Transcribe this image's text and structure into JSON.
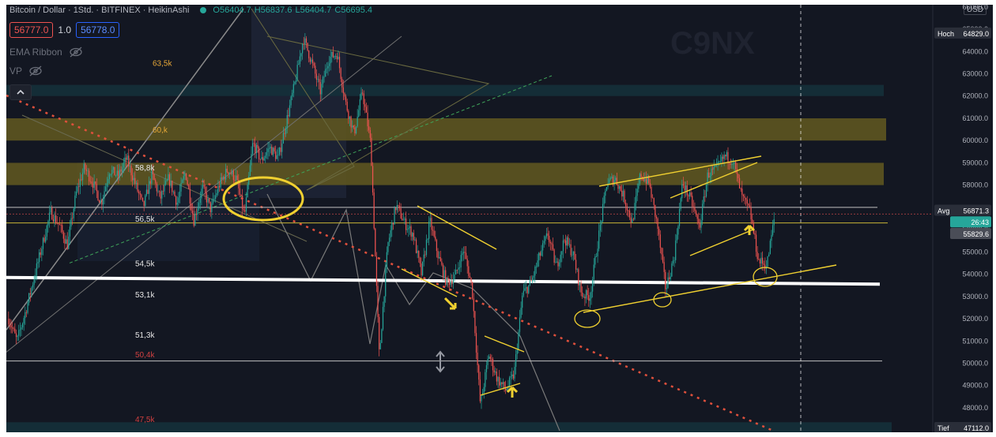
{
  "header": {
    "symbol": "Bitcoin / Dollar · 1Std. · BITFINEX · HeikinAshi",
    "ohlc": {
      "open": "O56404.7",
      "high": "H56837.6",
      "low": "L56404.7",
      "close": "C56695.4"
    },
    "sell_price": "56777.0",
    "spread": "1.0",
    "buy_price": "56778.0",
    "currency": "USD",
    "indicators": [
      {
        "label": "EMA Ribbon",
        "icon": "eye-off-icon"
      },
      {
        "label": "VP",
        "icon": "eye-off-icon"
      }
    ],
    "collapse_icon": "chevron-up-icon"
  },
  "watermark": "C9NX",
  "price_axis": {
    "ticks": [
      "66000.0",
      "65000.0",
      "64000.0",
      "63000.0",
      "62000.0",
      "61000.0",
      "60000.0",
      "59000.0",
      "58000.0",
      "57000.0",
      "56000.0",
      "55000.0",
      "54000.0",
      "53000.0",
      "52000.0",
      "51000.0",
      "50000.0",
      "49000.0",
      "48000.0"
    ],
    "tags": [
      {
        "name": "Hoch",
        "value": "64829.0",
        "bg": "#2a2e39",
        "fg": "#ffffff"
      },
      {
        "name": "Avg",
        "value": "56871.3",
        "bg": "#2a2e39",
        "fg": "#ffffff"
      },
      {
        "name": "",
        "value": "26:43",
        "bg": "#26a69a",
        "fg": "#ffffff"
      },
      {
        "name": "",
        "value": "55829.6",
        "bg": "#4a4d57",
        "fg": "#ffffff"
      },
      {
        "name": "Tief",
        "value": "47112.0",
        "bg": "#2a2e39",
        "fg": "#ffffff"
      }
    ]
  },
  "level_labels": [
    {
      "text": "63,5k",
      "color": "#e8a838"
    },
    {
      "text": "60,k",
      "color": "#e8a838"
    },
    {
      "text": "58,8k",
      "color": "#e6e6e6"
    },
    {
      "text": "56,5k",
      "color": "#e6e6e6"
    },
    {
      "text": "54,5k",
      "color": "#e6e6e6"
    },
    {
      "text": "53,1k",
      "color": "#e6e6e6"
    },
    {
      "text": "51,3k",
      "color": "#e6e6e6"
    },
    {
      "text": "50,4k",
      "color": "#d04040"
    },
    {
      "text": "47,5k",
      "color": "#d04040"
    }
  ],
  "chart_data": {
    "type": "candlestick",
    "title": "Bitcoin / Dollar · 1Std. · BITFINEX · HeikinAshi",
    "ylim": [
      46900,
      66100
    ],
    "y_ticks": [
      48000,
      49000,
      50000,
      51000,
      52000,
      53000,
      54000,
      55000,
      56000,
      57000,
      58000,
      59000,
      60000,
      61000,
      62000,
      63000,
      64000,
      65000,
      66000
    ],
    "candle_color_up": "#26a69a",
    "candle_color_down": "#ef5350",
    "close_path": [
      52000,
      51000,
      52300,
      53800,
      55300,
      56800,
      56200,
      55300,
      57600,
      58800,
      58100,
      57200,
      58700,
      58400,
      59200,
      58100,
      57000,
      58500,
      57400,
      58300,
      57200,
      58600,
      56400,
      57900,
      56900,
      58000,
      58700,
      58300,
      56600,
      59900,
      59100,
      59700,
      59200,
      60900,
      62600,
      64600,
      63500,
      62200,
      63700,
      63900,
      61700,
      60300,
      62200,
      59800,
      50300,
      55300,
      57100,
      56300,
      55800,
      54000,
      56400,
      54800,
      53600,
      53900,
      55100,
      53400,
      48100,
      50400,
      49300,
      48800,
      49500,
      53100,
      53600,
      54800,
      55800,
      54300,
      55600,
      54900,
      53100,
      53000,
      55600,
      58100,
      58300,
      57500,
      56300,
      58500,
      58100,
      56200,
      53300,
      54800,
      58100,
      57300,
      56100,
      58500,
      58700,
      59300,
      59100,
      57500,
      56800,
      54600,
      54400,
      56800
    ]
  }
}
